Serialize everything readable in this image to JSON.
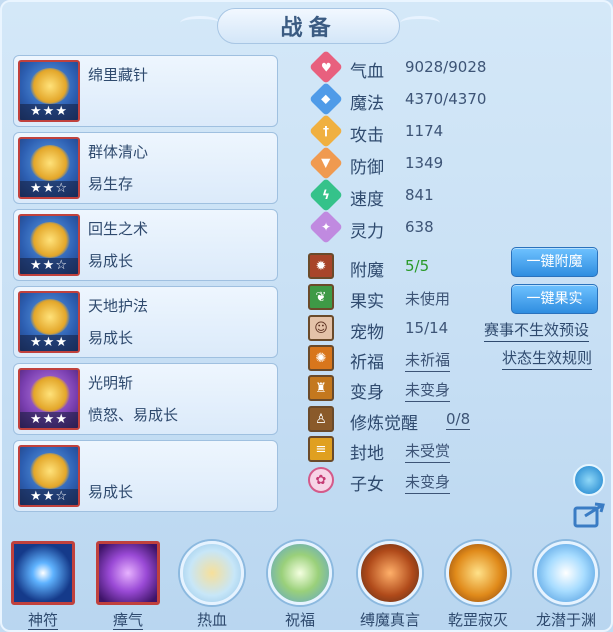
{
  "title": "战备",
  "skills": [
    {
      "name": "绵里藏针",
      "trait": "",
      "stars": "★★★",
      "tone": "blue"
    },
    {
      "name": "群体清心",
      "trait": "易生存",
      "stars": "★★☆",
      "tone": "blue"
    },
    {
      "name": "回生之术",
      "trait": "易成长",
      "stars": "★★☆",
      "tone": "blue"
    },
    {
      "name": "天地护法",
      "trait": "易成长",
      "stars": "★★★",
      "tone": "blue"
    },
    {
      "name": "光明斩",
      "trait": "愤怒、易成长",
      "stars": "★★★",
      "tone": "purple"
    },
    {
      "name": "",
      "trait": "易成长",
      "stars": "★★☆",
      "tone": "blue"
    }
  ],
  "stats": [
    {
      "label": "气血",
      "value": "9028/9028",
      "icon": "heart-icon",
      "color": "#e8607e"
    },
    {
      "label": "魔法",
      "value": "4370/4370",
      "icon": "mana-icon",
      "color": "#4f9be8"
    },
    {
      "label": "攻击",
      "value": "1174",
      "icon": "sword-icon",
      "color": "#f0b040"
    },
    {
      "label": "防御",
      "value": "1349",
      "icon": "shield-icon",
      "color": "#f09a50"
    },
    {
      "label": "速度",
      "value": "841",
      "icon": "speed-icon",
      "color": "#35c28a"
    },
    {
      "label": "灵力",
      "value": "638",
      "icon": "spirit-icon",
      "color": "#c08ae0"
    }
  ],
  "attributes": [
    {
      "label": "附魔",
      "value": "5/5",
      "icon": "enchant-icon",
      "style": "green"
    },
    {
      "label": "果实",
      "value": "未使用",
      "icon": "fruit-icon",
      "style": "plain"
    },
    {
      "label": "宠物",
      "value": "15/14",
      "icon": "pet-icon",
      "style": "plain"
    },
    {
      "label": "祈福",
      "value": "未祈福",
      "icon": "bless-icon",
      "style": "underline"
    },
    {
      "label": "变身",
      "value": "未变身",
      "icon": "transform-icon",
      "style": "underline"
    },
    {
      "label": "修炼觉醒",
      "value": "0/8",
      "icon": "cultivate-icon",
      "style": "underline"
    },
    {
      "label": "封地",
      "value": "未受赏",
      "icon": "fief-icon",
      "style": "underline"
    },
    {
      "label": "子女",
      "value": "未变身",
      "icon": "child-icon",
      "style": "underline"
    }
  ],
  "buttons": {
    "enchant_all": "一键附魔",
    "fruit_all": "一键果实",
    "preset_note": "赛事不生效预设",
    "status_rules": "状态生效规则"
  },
  "bottom_bar": [
    {
      "label": "神符",
      "kind": "square",
      "underline": true,
      "icon": "rune-icon"
    },
    {
      "label": "瘴气",
      "kind": "square",
      "underline": true,
      "icon": "miasma-icon"
    },
    {
      "label": "热血",
      "kind": "circle",
      "underline": false,
      "icon": "hotblood-icon"
    },
    {
      "label": "祝福",
      "kind": "circle",
      "underline": false,
      "icon": "blessing-icon"
    },
    {
      "label": "缚魔真言",
      "kind": "circle",
      "underline": false,
      "icon": "bind-demon-icon"
    },
    {
      "label": "乾罡寂灭",
      "kind": "circle",
      "underline": false,
      "icon": "qiangang-icon"
    },
    {
      "label": "龙潜于渊",
      "kind": "circle",
      "underline": false,
      "icon": "dragon-icon"
    }
  ]
}
